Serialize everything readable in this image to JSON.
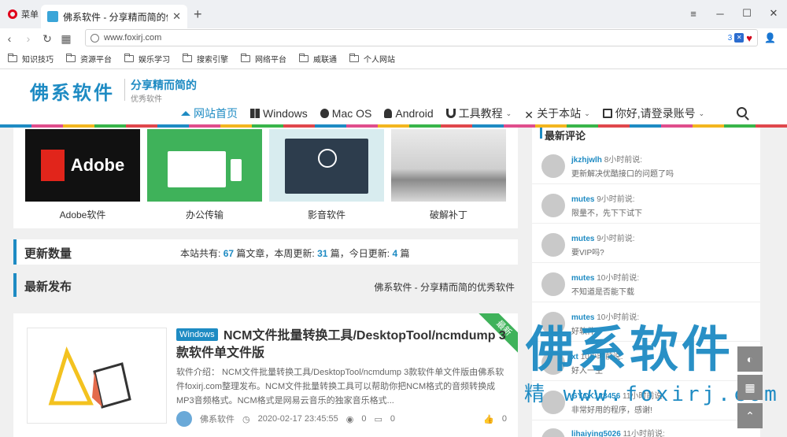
{
  "browser": {
    "menu_label": "菜单",
    "tab_title": "佛系软件 - 分享精而简的优",
    "url": "www.foxirj.com",
    "ext_count": "3"
  },
  "bookmarks": [
    "知识技巧",
    "资源平台",
    "娱乐学习",
    "搜索引擎",
    "网络平台",
    "威联通",
    "个人网站"
  ],
  "site": {
    "logo": "佛系软件",
    "tagline": "分享精而简的",
    "subtitle": "优秀软件",
    "nav": [
      {
        "label": "网站首页",
        "icon": "home-icon"
      },
      {
        "label": "Windows",
        "icon": "windows-icon"
      },
      {
        "label": "Mac OS",
        "icon": "apple-icon"
      },
      {
        "label": "Android",
        "icon": "android-icon"
      },
      {
        "label": "工具教程",
        "icon": "tool-icon"
      },
      {
        "label": "关于本站",
        "icon": "cross-icon"
      },
      {
        "label": "你好,请登录账号",
        "icon": "id-card-icon"
      }
    ]
  },
  "categories": [
    {
      "label": "Adobe软件",
      "img_text": "Adobe"
    },
    {
      "label": "办公传输"
    },
    {
      "label": "影音软件"
    },
    {
      "label": "破解补丁"
    }
  ],
  "stats": {
    "title": "更新数量",
    "prefix": "本站共有:",
    "total": "67",
    "mid": "篇文章，本周更新:",
    "week": "31",
    "mid2": "篇，今日更新:",
    "today": "4",
    "suffix": "篇"
  },
  "latest": {
    "title": "最新发布",
    "right": "佛系软件 - 分享精而简的优秀软件"
  },
  "post": {
    "badge": "Windows",
    "ribbon": "最新",
    "title": "NCM文件批量转换工具/DesktopTool/ncmdump 3款软件单文件版",
    "desc": "软件介绍： NCM文件批量转换工具/DesktopTool/ncmdump 3款软件单文件版由佛系软件foxirj.com整理发布。NCM文件批量转换工具可以帮助你把NCM格式的音频转换成MP3音频格式。NCM格式是网易云音乐的独家音乐格式...",
    "author": "佛系软件",
    "date": "2020-02-17 23:45:55",
    "views": "0",
    "comments": "0",
    "likes": "0"
  },
  "sidebar": {
    "title": "最新评论",
    "comments": [
      {
        "name": "jkzhjwlh",
        "time": "8小时前说:",
        "text": "更新解决优酷接口的问题了吗"
      },
      {
        "name": "mutes",
        "time": "9小时前说:",
        "text": "限量不，先下下试下"
      },
      {
        "name": "mutes",
        "time": "9小时前说:",
        "text": "要VIP吗?"
      },
      {
        "name": "mutes",
        "time": "10小时前说:",
        "text": "不知道是否能下载"
      },
      {
        "name": "mutes",
        "time": "10小时前说:",
        "text": "好软件"
      },
      {
        "name": "xt",
        "time": "10小时前说:",
        "text": "好人一生"
      },
      {
        "name": "GYCK123456",
        "time": "11小时前说:",
        "text": "非常好用的程序，感谢!"
      },
      {
        "name": "lihaiying5026",
        "time": "11小时前说:",
        "text": ""
      }
    ]
  },
  "watermark": {
    "text": "佛系软件",
    "sub": "精 www.foxirj.com"
  }
}
